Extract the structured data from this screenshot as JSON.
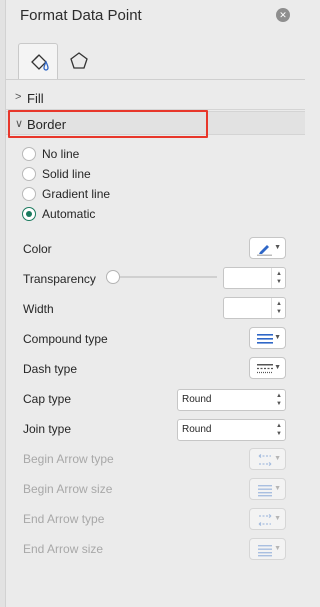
{
  "panel": {
    "title": "Format Data Point"
  },
  "tabs": [
    {
      "name": "fill-and-line-tab",
      "icon": "paint-bucket-icon",
      "active": true
    },
    {
      "name": "effects-shape-tab",
      "icon": "pentagon-icon",
      "active": false
    }
  ],
  "sections": {
    "fill": {
      "label": "Fill",
      "expanded": false
    },
    "border": {
      "label": "Border",
      "expanded": true
    }
  },
  "border_options": {
    "radios": [
      {
        "label": "No line",
        "checked": false
      },
      {
        "label": "Solid line",
        "checked": false
      },
      {
        "label": "Gradient line",
        "checked": false
      },
      {
        "label": "Automatic",
        "checked": true
      }
    ],
    "color": {
      "label": "Color",
      "icon": "pen-color-icon"
    },
    "transparency": {
      "label": "Transparency",
      "value": ""
    },
    "width": {
      "label": "Width",
      "value": ""
    },
    "compound_type": {
      "label": "Compound type",
      "icon": "compound-lines-icon"
    },
    "dash_type": {
      "label": "Dash type",
      "icon": "dash-lines-icon"
    },
    "cap_type": {
      "label": "Cap type",
      "value": "Round"
    },
    "join_type": {
      "label": "Join type",
      "value": "Round"
    },
    "begin_arrow_type": {
      "label": "Begin Arrow type",
      "icon": "arrow-type-icon",
      "enabled": false
    },
    "begin_arrow_size": {
      "label": "Begin Arrow size",
      "icon": "arrow-size-icon",
      "enabled": false
    },
    "end_arrow_type": {
      "label": "End Arrow type",
      "icon": "arrow-type-icon",
      "enabled": false
    },
    "end_arrow_size": {
      "label": "End Arrow size",
      "icon": "arrow-size-icon",
      "enabled": false
    }
  },
  "colors": {
    "accent": "#1a7a5e",
    "highlight": "#e8372b",
    "pen_blue": "#2f67c7"
  }
}
